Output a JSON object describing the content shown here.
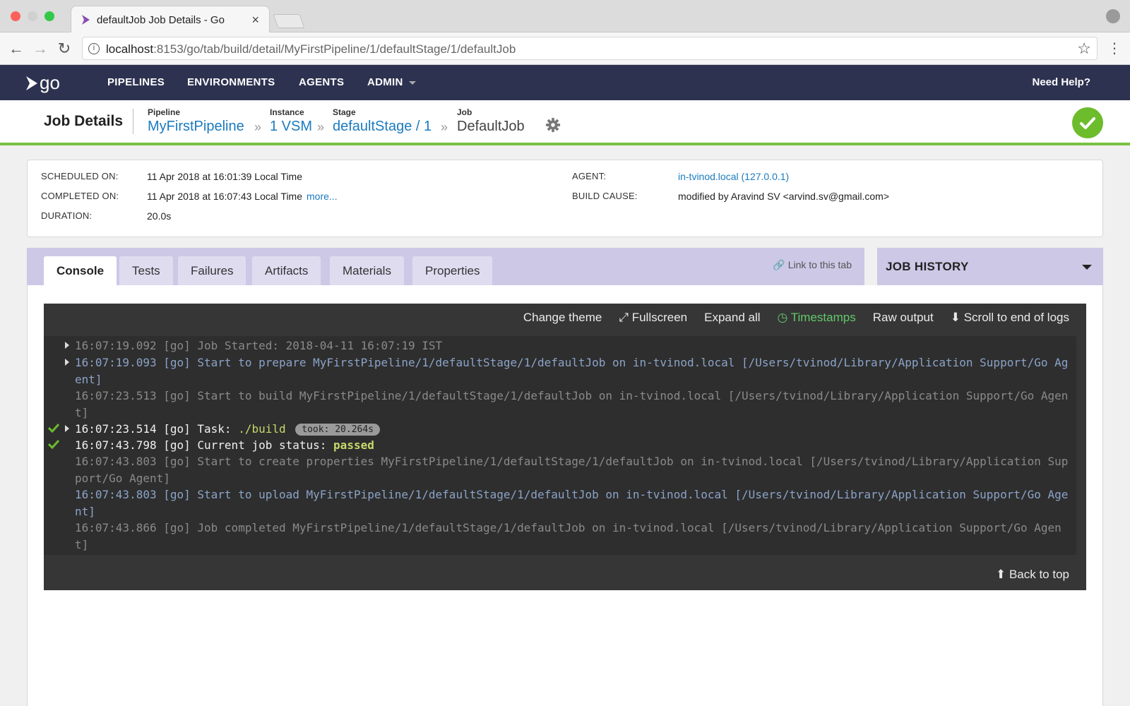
{
  "browser": {
    "tab_title": "defaultJob Job Details - Go",
    "tab_close": "×",
    "url_host": "localhost",
    "url_rest": ":8153/go/tab/build/detail/MyFirstPipeline/1/defaultStage/1/defaultJob"
  },
  "nav": {
    "logo_text": "go",
    "items": [
      "PIPELINES",
      "ENVIRONMENTS",
      "AGENTS",
      "ADMIN"
    ],
    "help": "Need Help?"
  },
  "breadcrumb": {
    "title": "Job Details",
    "pipeline_label": "Pipeline",
    "pipeline_value": "MyFirstPipeline",
    "instance_label": "Instance",
    "instance_value": "1 VSM",
    "stage_label": "Stage",
    "stage_value": "defaultStage / 1",
    "job_label": "Job",
    "job_value": "DefaultJob",
    "sep": "»"
  },
  "summary": {
    "scheduled_key": "SCHEDULED ON:",
    "scheduled_val": "11 Apr 2018 at 16:01:39 Local Time",
    "completed_key": "COMPLETED ON:",
    "completed_val": "11 Apr 2018 at 16:07:43 Local Time",
    "more": "more...",
    "duration_key": "DURATION:",
    "duration_val": "20.0s",
    "agent_key": "AGENT:",
    "agent_val": "in-tvinod.local (127.0.0.1)",
    "cause_key": "BUILD CAUSE:",
    "cause_val": "modified by Aravind SV <arvind.sv@gmail.com>"
  },
  "tabs": [
    "Console",
    "Tests",
    "Failures",
    "Artifacts",
    "Materials",
    "Properties"
  ],
  "link_tab": "Link to this tab",
  "job_history": "JOB HISTORY",
  "console": {
    "toolbar": [
      "Change theme",
      "Fullscreen",
      "Expand all",
      "Timestamps",
      "Raw output",
      "Scroll to end of logs"
    ],
    "lines": [
      "16:07:19.092 [go] Job Started: 2018-04-11 16:07:19 IST",
      "16:07:19.093 [go] Start to prepare MyFirstPipeline/1/defaultStage/1/defaultJob on in-tvinod.local [/Users/tvinod/Library/Application Support/Go Agent]",
      "16:07:23.513 [go] Start to build MyFirstPipeline/1/defaultStage/1/defaultJob on in-tvinod.local [/Users/tvinod/Library/Application Support/Go Agent]",
      "16:07:23.514 [go] Task: ",
      "16:07:43.798 [go] Current job status: ",
      "16:07:43.803 [go] Start to create properties MyFirstPipeline/1/defaultStage/1/defaultJob on in-tvinod.local [/Users/tvinod/Library/Application Support/Go Agent]",
      "16:07:43.803 [go] Start to upload MyFirstPipeline/1/defaultStage/1/defaultJob on in-tvinod.local [/Users/tvinod/Library/Application Support/Go Agent]",
      "16:07:43.866 [go] Job completed MyFirstPipeline/1/defaultStage/1/defaultJob on in-tvinod.local [/Users/tvinod/Library/Application Support/Go Agent]"
    ],
    "task_name": "./build",
    "took": "took: 20.264s",
    "status": "passed",
    "back_to_top": "Back to top"
  },
  "colors": {
    "header": "#2d3250",
    "success": "#6cbc2c",
    "link": "#1b7abf",
    "tab_bar": "#ccc8e6",
    "console_bg": "#363636"
  }
}
